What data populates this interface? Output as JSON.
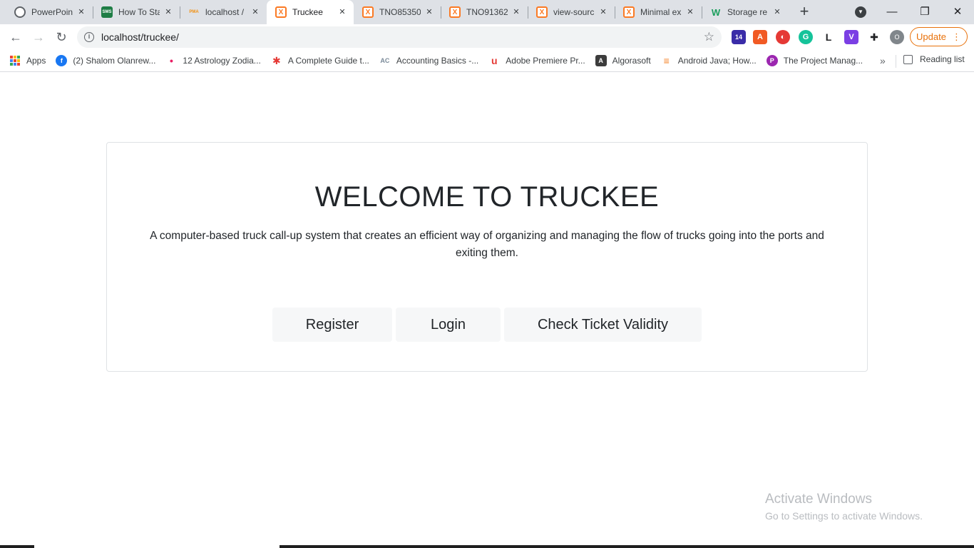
{
  "browser": {
    "tabs": [
      {
        "title": "PowerPoint",
        "icon": "globe-icon",
        "color": "#5f6368",
        "active": false
      },
      {
        "title": "How To Sta",
        "icon": "sms-icon",
        "color": "#1e7d45",
        "glyph": "SMS",
        "active": false
      },
      {
        "title": "localhost /",
        "icon": "phpmyadmin-icon",
        "color": "#f29111",
        "glyph": "PMA",
        "active": false
      },
      {
        "title": "Truckee",
        "icon": "xampp-icon",
        "color": "#fb7a24",
        "glyph": "X",
        "active": true
      },
      {
        "title": "TNO85350",
        "icon": "xampp-icon",
        "color": "#fb7a24",
        "glyph": "X",
        "active": false
      },
      {
        "title": "TNO91362",
        "icon": "xampp-icon",
        "color": "#fb7a24",
        "glyph": "X",
        "active": false
      },
      {
        "title": "view-sourc",
        "icon": "xampp-icon",
        "color": "#fb7a24",
        "glyph": "X",
        "active": false
      },
      {
        "title": "Minimal ex",
        "icon": "xampp-icon",
        "color": "#fb7a24",
        "glyph": "X",
        "active": false
      },
      {
        "title": "Storage re",
        "icon": "w-icon",
        "color": "#1a9e5c",
        "glyph": "W",
        "active": false
      }
    ],
    "new_tab": "+",
    "window_controls": {
      "minimize": "—",
      "maximize": "❐",
      "close": "✕"
    },
    "url": "localhost/truckee/",
    "extensions": [
      {
        "name": "graduation-cap-extension-icon",
        "color": "#3a2ca8",
        "glyph": "14"
      },
      {
        "name": "translate-extension-icon",
        "color": "#f15a24",
        "glyph": "A"
      },
      {
        "name": "red-circle-extension-icon",
        "color": "#e53935",
        "glyph": "◐"
      },
      {
        "name": "grammarly-extension-icon",
        "color": "#15c39a",
        "glyph": "G"
      },
      {
        "name": "l-extension-icon",
        "color": "#ffffff",
        "glyph": "L"
      },
      {
        "name": "v-extension-icon",
        "color": "#7b3fe4",
        "glyph": "V"
      },
      {
        "name": "puzzle-extension-icon",
        "color": "#ffffff",
        "glyph": "✚"
      }
    ],
    "profile_initial": "O",
    "update_label": "Update",
    "bookmarks": [
      {
        "label": "Apps",
        "icon": "apps-grid-icon"
      },
      {
        "label": "(2) Shalom Olanrew...",
        "icon": "facebook-icon",
        "color": "#1877f2",
        "glyph": "f"
      },
      {
        "label": "12 Astrology Zodia...",
        "icon": "astrology-icon",
        "color": "#e91e63",
        "glyph": "•"
      },
      {
        "label": "A Complete Guide t...",
        "icon": "asterisk-icon",
        "color": "#e53935",
        "glyph": "✱"
      },
      {
        "label": "Accounting Basics -...",
        "icon": "ac-icon",
        "color": "#7a8a99",
        "glyph": "AC"
      },
      {
        "label": "Adobe Premiere Pr...",
        "icon": "adobe-icon",
        "color": "#e53935",
        "glyph": "u"
      },
      {
        "label": "Algorasoft",
        "icon": "algorasoft-icon",
        "color": "#3c3c3c",
        "glyph": "A"
      },
      {
        "label": "Android Java; How...",
        "icon": "stackoverflow-icon",
        "color": "#f48024",
        "glyph": "≡"
      },
      {
        "label": "The Project Manag...",
        "icon": "project-icon",
        "color": "#9c27b0",
        "glyph": "P"
      }
    ],
    "bookmarks_overflow": "»",
    "reading_list": "Reading list"
  },
  "page": {
    "heading": "WELCOME TO TRUCKEE",
    "description": "A computer-based truck call-up system that creates an efficient way of organizing and managing the flow of trucks going into the ports and exiting them.",
    "buttons": {
      "register": "Register",
      "login": "Login",
      "check_ticket": "Check Ticket Validity"
    }
  },
  "watermark": {
    "title": "Activate Windows",
    "subtitle": "Go to Settings to activate Windows."
  }
}
